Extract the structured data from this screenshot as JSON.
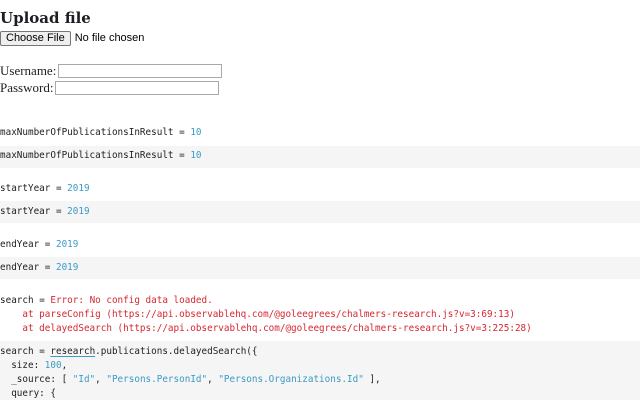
{
  "upload": {
    "title": "Upload file",
    "choose_button": "Choose File",
    "status": "No file chosen"
  },
  "login": {
    "username_label": "Username:",
    "password_label": "Password:"
  },
  "cells": {
    "max_output": {
      "name": "maxNumberOfPublicationsInResult",
      "op": " = ",
      "value": "10"
    },
    "max_code": {
      "name": "maxNumberOfPublicationsInResult",
      "op": " = ",
      "value": "10"
    },
    "start_output": {
      "name": "startYear",
      "op": " = ",
      "value": "2019"
    },
    "start_code": {
      "name": "startYear",
      "op": " = ",
      "value": "2019"
    },
    "end_output": {
      "name": "endYear",
      "op": " = ",
      "value": "2019"
    },
    "end_code": {
      "name": "endYear",
      "op": " = ",
      "value": "2019"
    },
    "search_output": {
      "name": "search",
      "op": " = ",
      "error": "Error: No config data loaded.",
      "trace1": "    at parseConfig (https://api.observablehq.com/@goleegrees/chalmers-research.js?v=3:69:13)",
      "trace2": "    at delayedSearch (https://api.observablehq.com/@goleegrees/chalmers-research.js?v=3:225:28)"
    },
    "search_code": {
      "line1_name": "search",
      "line1_op": " = ",
      "line1_ref": "research",
      "line1_rest": ".publications.delayedSearch({",
      "line2_key": "  size: ",
      "line2_value": "100",
      "line2_end": ",",
      "line3_key": "  _source: [ ",
      "line3_s1": "\"Id\"",
      "line3_sep1": ", ",
      "line3_s2": "\"Persons.PersonId\"",
      "line3_sep2": ", ",
      "line3_s3": "\"Persons.Organizations.Id\"",
      "line3_end": " ],",
      "line4": "  query: {"
    }
  }
}
